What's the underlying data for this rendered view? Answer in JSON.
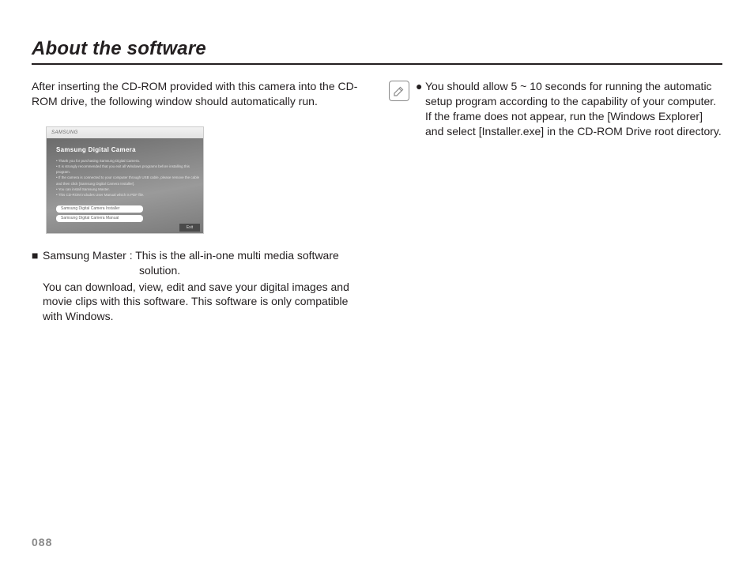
{
  "title": "About the software",
  "page_number": "088",
  "left": {
    "intro": "After inserting the CD-ROM provided with this camera into the CD-ROM drive, the following window should automatically run.",
    "figure": {
      "logo": "SAMSUNG",
      "heading": "Samsung Digital Camera",
      "bullets": [
        "Thank you for purchasing Samsung Digital Camera.",
        "It is strongly recommended that you exit all Windows programs before installing this program.",
        "If the camera is connected to your computer through USB cable, please remove the cable and then click [Samsung Digital Camera Installer].",
        "You can install Samsung Master.",
        "This CD-ROM includes User Manual which is PDF file."
      ],
      "buttons": [
        "Samsung Digital Camera Installer",
        "Samsung Digital Camera Manual"
      ],
      "exit": "Exit"
    },
    "samsung_master": {
      "mark": "■",
      "label": "Samsung Master : ",
      "desc_first": "This is the all-in-one multi media software",
      "desc_cont": "solution.",
      "body": "You can download, view, edit and save your digital images and movie clips with this software. This software is only compatible with Windows."
    }
  },
  "right": {
    "note": {
      "bullet": "●",
      "text": "You should allow 5 ~ 10 seconds for running the automatic setup program according to the capability of your computer. If the frame does not appear, run the [Windows Explorer] and select [Installer.exe] in the CD-ROM Drive root directory."
    }
  }
}
